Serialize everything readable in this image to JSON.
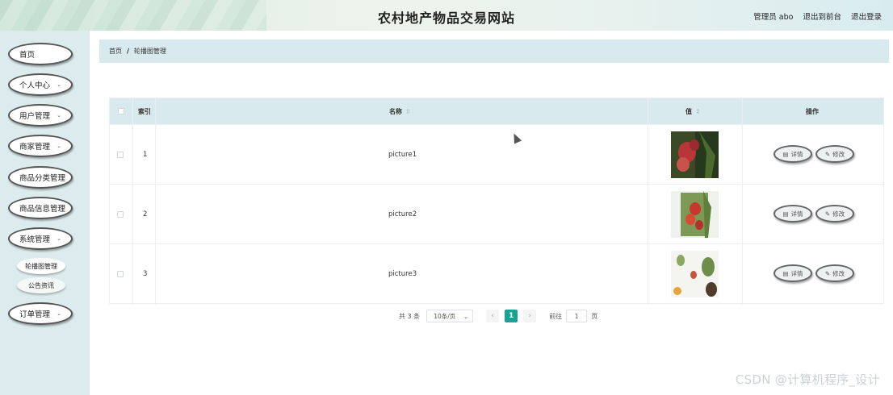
{
  "header": {
    "title": "农村地产物品交易网站",
    "admin_label": "管理员 abo",
    "back_front": "退出到前台",
    "logout": "退出登录"
  },
  "sidebar": {
    "items": [
      {
        "label": "首页",
        "has_submenu": false
      },
      {
        "label": "个人中心",
        "has_submenu": true
      },
      {
        "label": "用户管理",
        "has_submenu": true
      },
      {
        "label": "商家管理",
        "has_submenu": true
      },
      {
        "label": "商品分类管理",
        "has_submenu": false
      },
      {
        "label": "商品信息管理",
        "has_submenu": false
      },
      {
        "label": "系统管理",
        "has_submenu": true
      },
      {
        "label": "订单管理",
        "has_submenu": true
      }
    ],
    "subitems": [
      {
        "label": "轮播图管理",
        "active": true
      },
      {
        "label": "公告资讯",
        "active": false
      }
    ]
  },
  "breadcrumb": {
    "home": "首页",
    "separator": "/",
    "current": "轮播图管理"
  },
  "table": {
    "columns": {
      "index": "索引",
      "name": "名称",
      "value": "值",
      "actions": "操作"
    },
    "rows": [
      {
        "index": "1",
        "name": "picture1",
        "thumb": "red-fruit-photo"
      },
      {
        "index": "2",
        "name": "picture2",
        "thumb": "red-fruit-on-white-photo"
      },
      {
        "index": "3",
        "name": "picture3",
        "thumb": "fruit-branch-photo"
      }
    ],
    "detail_label": "详情",
    "edit_label": "修改"
  },
  "pagination": {
    "total": "共 3 条",
    "page_size": "10条/页",
    "prev": "‹",
    "current_page": "1",
    "next": "›",
    "goto_label": "前往",
    "goto_value": "1",
    "page_suffix": "页"
  },
  "watermark": "CSDN @计算机程序_设计",
  "colors": {
    "sidebar_bg": "#dcecee",
    "table_header_bg": "#d9eaee",
    "pager_active": "#1aa394"
  }
}
